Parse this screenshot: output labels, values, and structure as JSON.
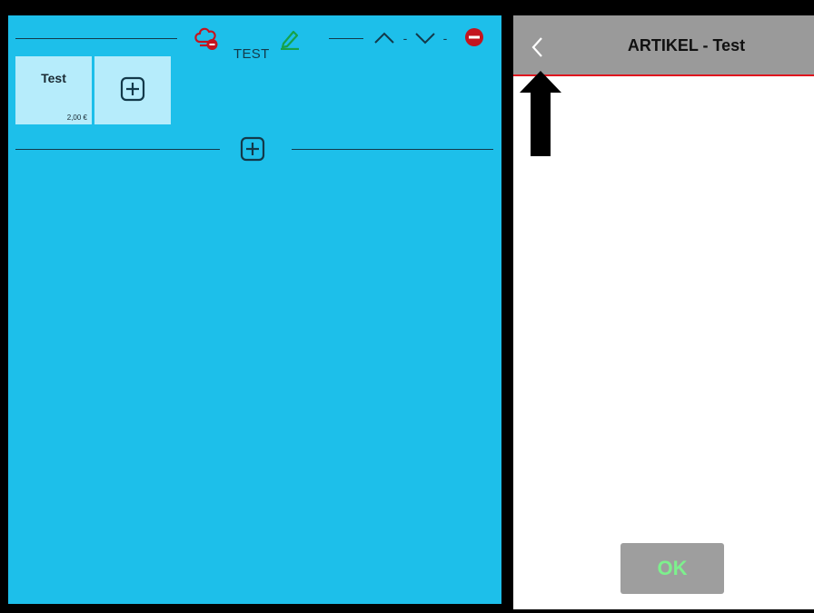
{
  "menu": {
    "category_name": "TEST",
    "items": [
      {
        "name": "Test",
        "price": "2,00 €"
      }
    ]
  },
  "article_panel": {
    "title": "ARTIKEL - Test",
    "ok_label": "OK"
  },
  "colors": {
    "menu_background": "#1dbfea",
    "tile_background": "#b6ecfb",
    "header_background": "#9a9a9a",
    "header_border": "#e0141e",
    "ok_text": "#7df08d",
    "remove_icon": "#c4141e",
    "edit_icon": "#16a24a"
  },
  "icons": {
    "category": "chef-hat-remove-icon",
    "edit": "pencil-icon",
    "move_up": "chevron-up-icon",
    "move_down": "chevron-down-icon",
    "remove": "minus-circle-icon",
    "add_item": "plus-square-icon",
    "add_category": "plus-square-icon",
    "back": "chevron-left-icon",
    "pointer": "black-arrow-up"
  }
}
